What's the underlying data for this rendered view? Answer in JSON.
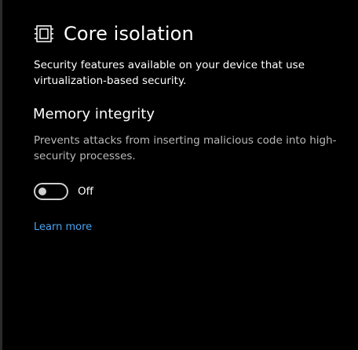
{
  "header": {
    "title": "Core isolation",
    "icon": "core-isolation-chip-icon"
  },
  "page": {
    "description": "Security features available on your device that use virtualization-based security."
  },
  "memory_integrity": {
    "title": "Memory integrity",
    "description": "Prevents attacks from inserting malicious code into high-security processes.",
    "toggle_state": "Off",
    "toggle_on": false
  },
  "links": {
    "learn_more": "Learn more"
  },
  "colors": {
    "background": "#000000",
    "text": "#ffffff",
    "secondary_text": "#b9b9b9",
    "link": "#4aa3ef",
    "toggle_outline": "#cfcfcf"
  }
}
